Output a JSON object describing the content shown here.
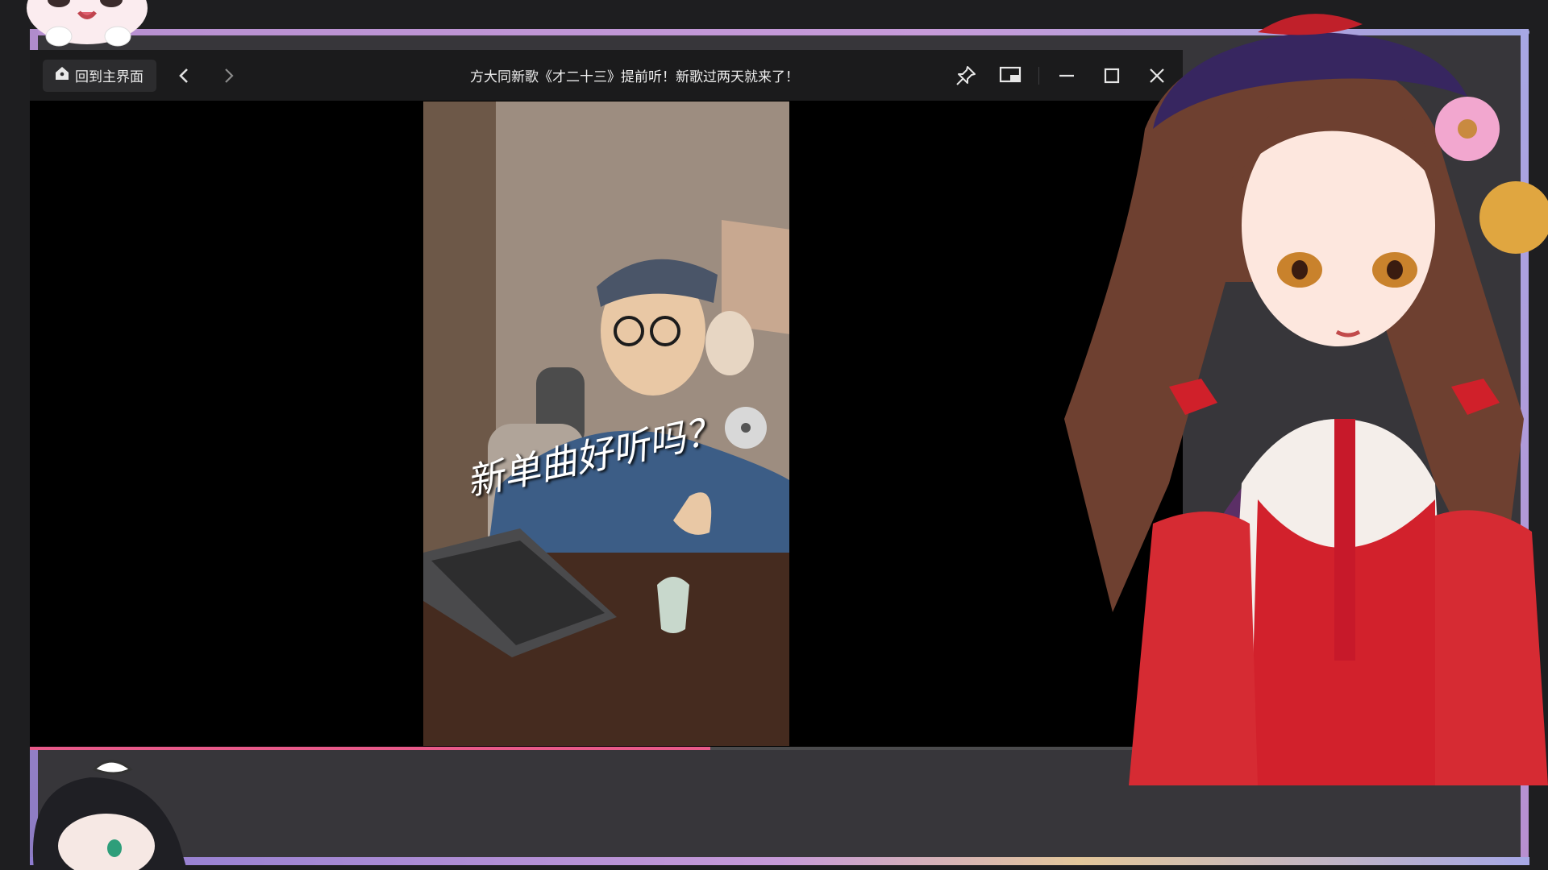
{
  "window": {
    "home_label": "回到主界面",
    "title": "方大同新歌《才二十三》提前听！新歌过两天就来了！"
  },
  "video": {
    "caption": "新单曲好听吗？",
    "progress_fraction": 0.59
  },
  "icons": {
    "home": "home-icon",
    "back": "chevron-left-icon",
    "forward": "chevron-right-icon",
    "pin": "pin-icon",
    "pip": "picture-in-picture-icon",
    "minimize": "minimize-icon",
    "maximize": "maximize-icon",
    "close": "close-icon"
  },
  "colors": {
    "accent": "#e85a8a",
    "frame": "#c79bd9"
  }
}
